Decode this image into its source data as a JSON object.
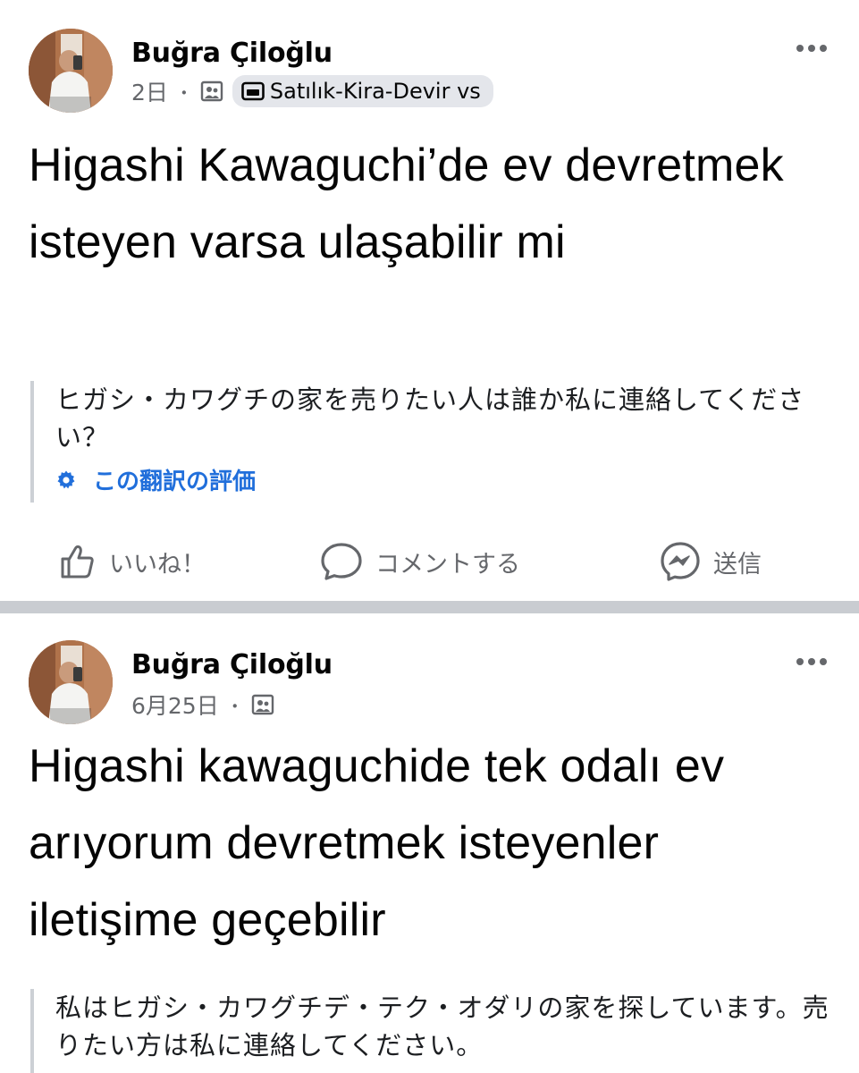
{
  "posts": [
    {
      "author": "Buğra Çiloğlu",
      "time": "2日",
      "separator": "・",
      "audience_icon": "group-members-icon",
      "group_chip": {
        "icon": "group-icon",
        "label": "Satılık-Kira-Devir vs"
      },
      "more_icon": "more-options-icon",
      "text": "Higashi Kawaguchi’de ev devretmek isteyen varsa ulaşabilir mi",
      "translation": "ヒガシ・カワグチの家を売りたい人は誰か私に連絡してください？",
      "rate_translation": {
        "icon": "gear-icon",
        "label": "この翻訳の評価"
      },
      "actions": {
        "like": {
          "icon": "thumbs-up-icon",
          "label": "いいね！"
        },
        "comment": {
          "icon": "comment-icon",
          "label": "コメントする"
        },
        "send": {
          "icon": "messenger-icon",
          "label": "送信"
        }
      }
    },
    {
      "author": "Buğra Çiloğlu",
      "time": "6月25日",
      "separator": "・",
      "audience_icon": "group-members-icon",
      "more_icon": "more-options-icon",
      "text": "Higashi kawaguchide tek odalı ev arıyorum devretmek isteyenler iletişime geçebilir",
      "translation": "私はヒガシ・カワグチデ・テク・オダリの家を探しています。売りたい方は私に連絡してください。"
    }
  ],
  "colors": {
    "text": "#050505",
    "secondary": "#65676b",
    "link": "#216fdb",
    "separator": "#c9ccd1",
    "chip": "#e4e6eb"
  }
}
